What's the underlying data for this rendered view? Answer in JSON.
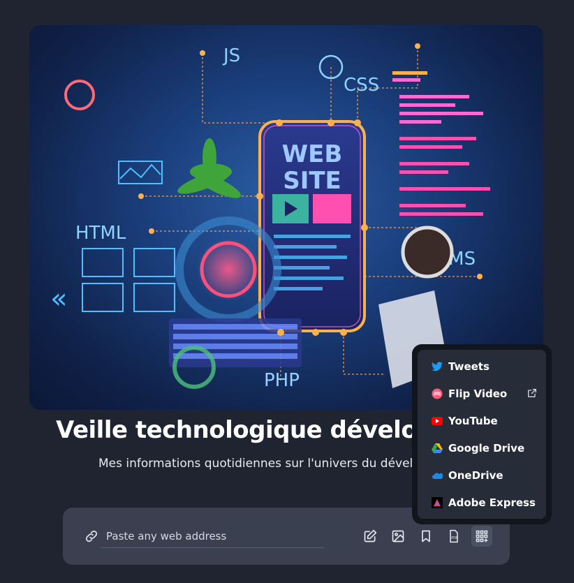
{
  "hero": {
    "alt": "Web site development illustration",
    "labels": [
      "JS",
      "CSS",
      "WEB",
      "SITE",
      "HTML",
      "CMS",
      "PHP"
    ]
  },
  "title": "Veille technologique développer",
  "subtitle": "Mes informations quotidiennes sur l'univers du développ",
  "search": {
    "placeholder": "Paste any web address",
    "value": ""
  },
  "tools": [
    "edit-icon",
    "image-icon",
    "bookmark-icon",
    "pdf-icon",
    "apps-grid-icon"
  ],
  "menu": {
    "items": [
      {
        "label": "Tweets",
        "icon": "twitter-icon",
        "color": "#1d9bf0"
      },
      {
        "label": "Flip Video",
        "icon": "flip-video-icon",
        "color": "#ff5a7a"
      },
      {
        "label": "YouTube",
        "icon": "youtube-icon",
        "color": "#ff0000"
      },
      {
        "label": "Google Drive",
        "icon": "google-drive-icon",
        "color": "#34a853"
      },
      {
        "label": "OneDrive",
        "icon": "onedrive-icon",
        "color": "#1e88e5"
      },
      {
        "label": "Adobe Express",
        "icon": "adobe-express-icon",
        "color": "#e34850"
      }
    ]
  }
}
